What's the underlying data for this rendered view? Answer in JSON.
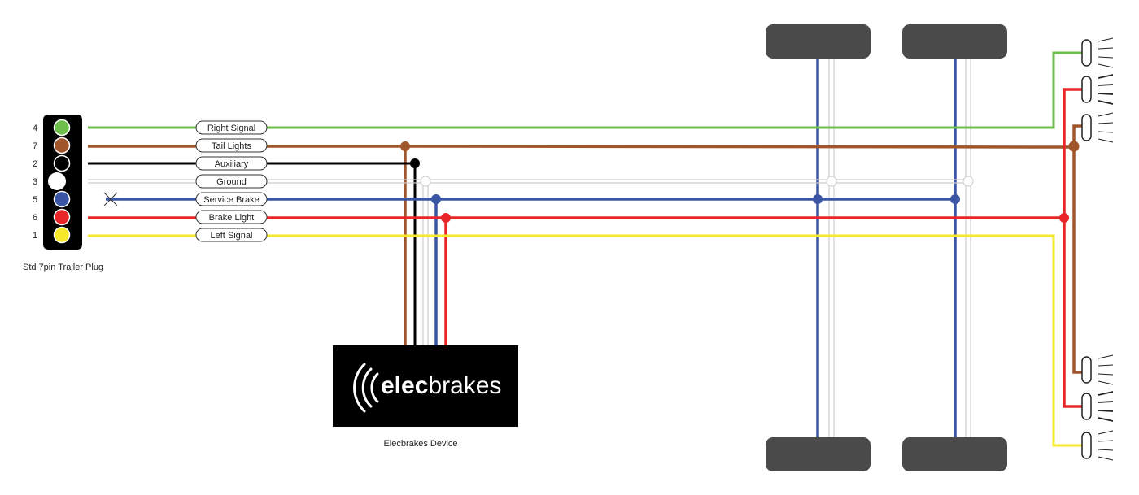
{
  "plug": {
    "title": "Std 7pin Trailer Plug",
    "pins": [
      {
        "number": "4",
        "label": "Right Signal",
        "color": "#6cbf4a"
      },
      {
        "number": "7",
        "label": "Tail Lights",
        "color": "#a0562a"
      },
      {
        "number": "2",
        "label": "Auxiliary",
        "color": "#000000"
      },
      {
        "number": "3",
        "label": "Ground",
        "color": "#ffffff"
      },
      {
        "number": "5",
        "label": "Service Brake",
        "color": "#3a55a4"
      },
      {
        "number": "6",
        "label": "Brake Light",
        "color": "#e8262a"
      },
      {
        "number": "1",
        "label": "Left Signal",
        "color": "#f5e92a"
      }
    ]
  },
  "device": {
    "logo_bold": "elec",
    "logo_light": "brakes",
    "caption": "Elecbrakes Device"
  },
  "colors": {
    "wheel": "#4a4a4a",
    "device_bg": "#000000",
    "ground_wire": "#cccccc"
  }
}
